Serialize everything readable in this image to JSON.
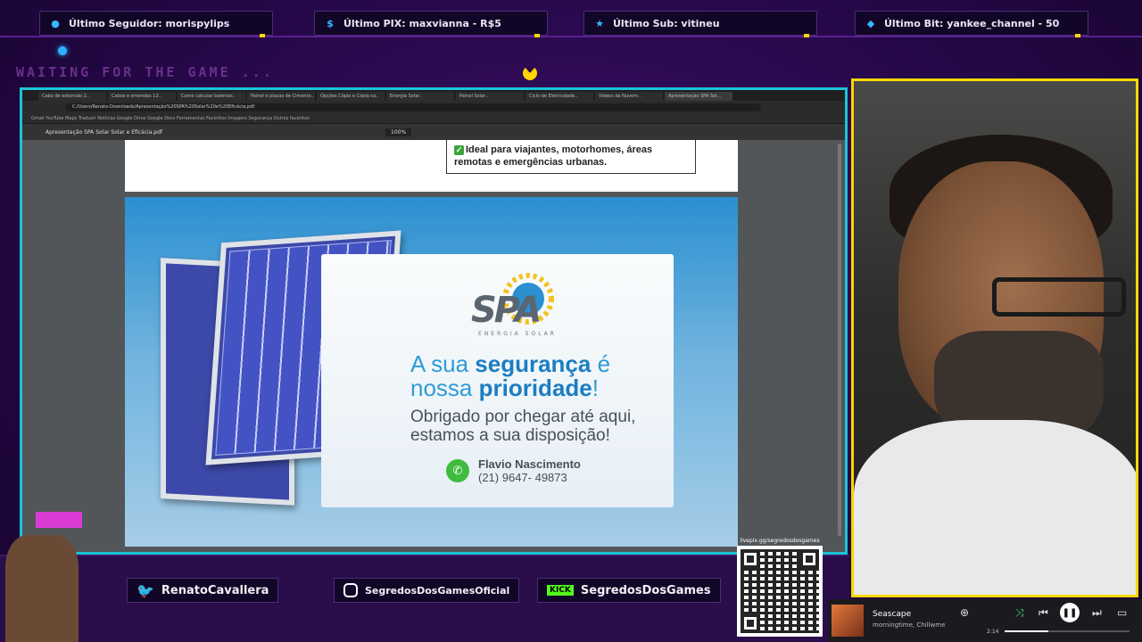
{
  "alerts": [
    {
      "icon": "user-icon",
      "label": "Último Seguidor: morispylips"
    },
    {
      "icon": "dollar-icon",
      "label": "Último PIX: maxvianna - R$5"
    },
    {
      "icon": "star-icon",
      "label": "Último Sub: vitineu"
    },
    {
      "icon": "diamond-icon",
      "label": "Último Bit: yankee_channel - 50"
    }
  ],
  "overlay": {
    "waiting": "WAITING FOR THE GAME ..."
  },
  "browser": {
    "tabs": [
      "Cabo de extensão 2..",
      "Cabos e emendas 12..",
      "Como calcular baterias..",
      "Painel e placas de Cimento..",
      "Opções Cópia e Cópia ca..",
      "Energia Solar..",
      "Painel Solar..",
      "Ciclo de Eletricidade..",
      "Vídeos da Nuvem..",
      "Apresentação SPA Sol..."
    ],
    "url": "C:/Users/Renato-Downloads/Apresentação%20SPA%20Solar%20e%20Eficácia.pdf",
    "bookmarks": "Gmail   YouTube   Maps   Traduzir   Notícias   Google Drive   Google Docs   Ferramentas   Favoritos   Imagens   Segurança   Outros favoritos",
    "pdf_file": "Apresentação SPA Solar Solar e Eficácia.pdf",
    "zoom": "100%"
  },
  "pdf": {
    "check_text": "Ideal para viajantes, motorhomes, áreas remotas e emergências urbanas.",
    "logo": "SPA",
    "logo_sub": "ENERGIA SOLAR",
    "headline_1": "A sua ",
    "headline_2": "segurança",
    "headline_3": " é nossa ",
    "headline_4": "prioridade",
    "headline_5": "!",
    "thanks": "Obrigado por chegar até aqui, estamos a sua disposição!",
    "contact_name": "Flavio Nascimento",
    "contact_phone": "(21) 9647- 49873"
  },
  "socials": [
    {
      "icon": "twitter-icon",
      "label": "RenatoCavallera"
    },
    {
      "icon": "instagram-icon",
      "label": "SegredosDosGamesOficial"
    },
    {
      "icon": "kick-icon",
      "badge": "KICK",
      "label": "SegredosDosGames"
    }
  ],
  "qr_label": "livepix.gg/segredosdosgames",
  "player": {
    "song": "Seascape",
    "artist": "morningtime, Chillwme",
    "time": "2:14",
    "progress": 0.35
  },
  "colors": {
    "frame": "#1cc3d8",
    "cam_border": "#f5d800",
    "accent": "#2f9bd6"
  }
}
